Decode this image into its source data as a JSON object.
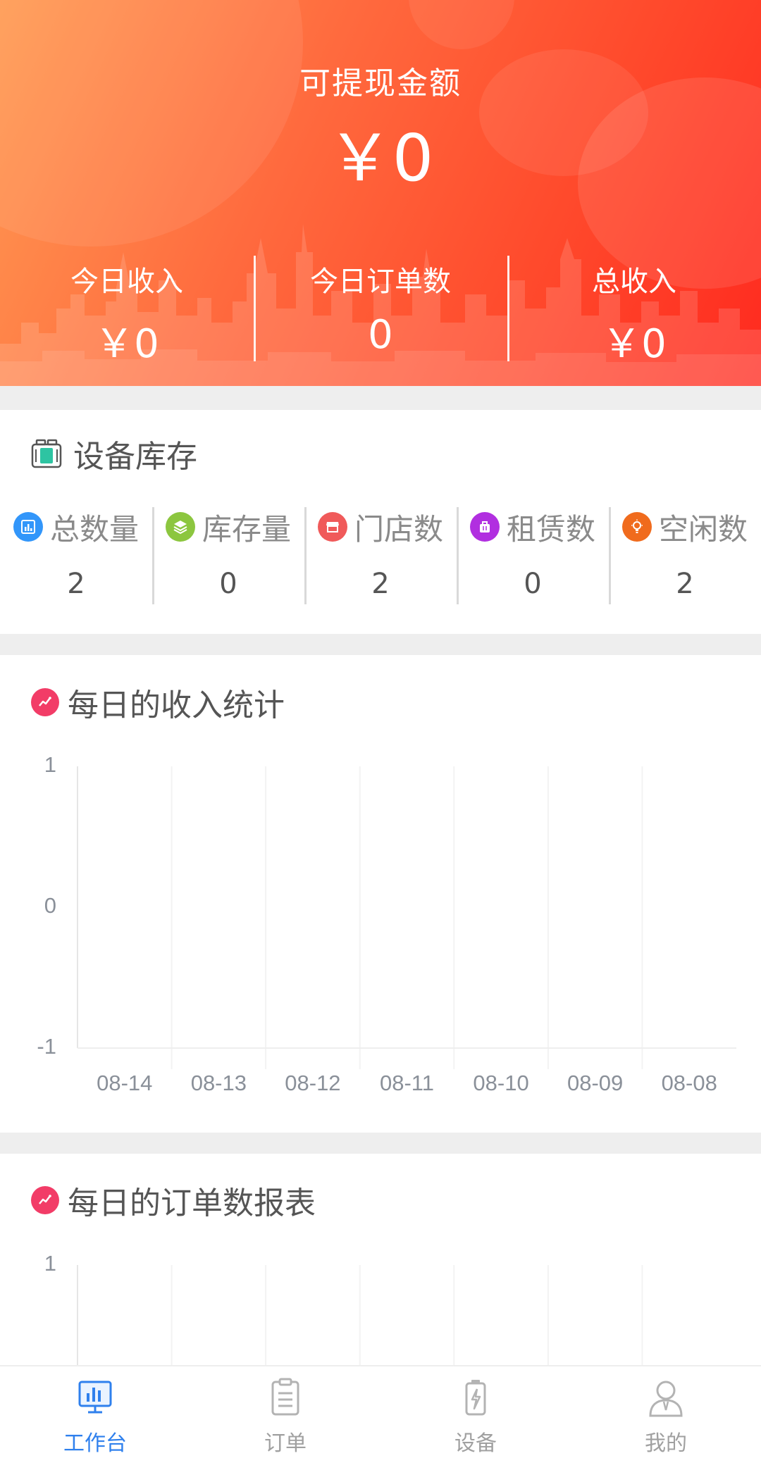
{
  "header": {
    "withdrawable_label": "可提现金额",
    "withdrawable_amount": "￥0",
    "stats": [
      {
        "label": "今日收入",
        "value": "￥0"
      },
      {
        "label": "今日订单数",
        "value": "0"
      },
      {
        "label": "总收入",
        "value": "￥0"
      }
    ]
  },
  "inventory": {
    "title": "设备库存",
    "items": [
      {
        "label": "总数量",
        "value": "2",
        "icon": "chart-icon",
        "color": "#3296fa"
      },
      {
        "label": "库存量",
        "value": "0",
        "icon": "layers-icon",
        "color": "#8cc63f"
      },
      {
        "label": "门店数",
        "value": "2",
        "icon": "store-icon",
        "color": "#f05a5a"
      },
      {
        "label": "租赁数",
        "value": "0",
        "icon": "bag-icon",
        "color": "#b12fe0"
      },
      {
        "label": "空闲数",
        "value": "2",
        "icon": "bulb-icon",
        "color": "#f06b1d"
      }
    ]
  },
  "income_chart_title": "每日的收入统计",
  "orders_chart_title": "每日的订单数报表",
  "chart_data": [
    {
      "type": "line",
      "title": "每日的收入统计",
      "categories": [
        "08-14",
        "08-13",
        "08-12",
        "08-11",
        "08-10",
        "08-09",
        "08-08"
      ],
      "y_ticks": [
        "1",
        "0",
        "-1"
      ],
      "ylim": [
        -1,
        1
      ],
      "grid": true,
      "series": []
    },
    {
      "type": "line",
      "title": "每日的订单数报表",
      "y_ticks": [
        "1"
      ],
      "grid": true,
      "series": []
    }
  ],
  "tabbar": {
    "tabs": [
      {
        "label": "工作台",
        "icon": "dashboard-icon",
        "active": true
      },
      {
        "label": "订单",
        "icon": "clipboard-icon",
        "active": false
      },
      {
        "label": "设备",
        "icon": "battery-icon",
        "active": false
      },
      {
        "label": "我的",
        "icon": "user-icon",
        "active": false
      }
    ]
  },
  "colors": {
    "accent": "#2f80ed",
    "hero_start": "#ff9a52",
    "hero_end": "#ff2a1f",
    "chart_icon": "#f23c67"
  }
}
